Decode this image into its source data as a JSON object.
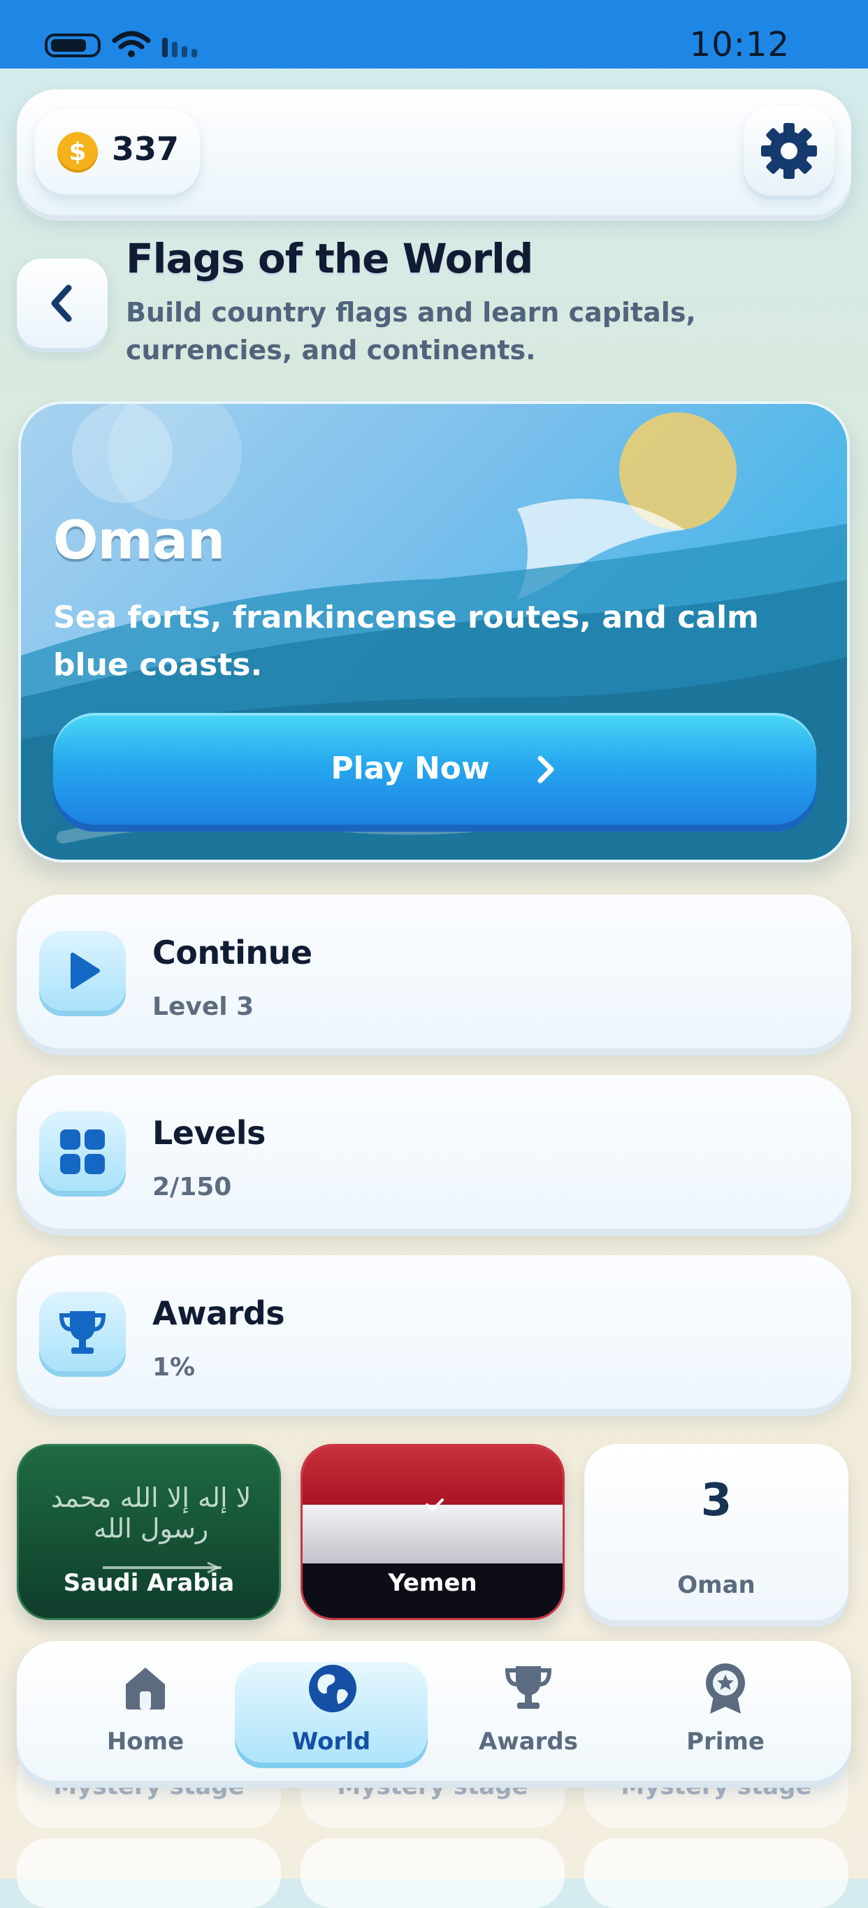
{
  "status_bar": {
    "time": "10:12"
  },
  "header": {
    "coins": "337",
    "coin_symbol": "$"
  },
  "page": {
    "title": "Flags of the World",
    "subtitle": "Build country flags and learn capitals, currencies, and continents."
  },
  "hero": {
    "country": "Oman",
    "description": "Sea forts, frankincense routes, and calm blue coasts.",
    "play_label": "Play Now"
  },
  "cards": [
    {
      "title": "Continue",
      "subtitle": "Level 3",
      "icon": "play-icon"
    },
    {
      "title": "Levels",
      "subtitle": "2/150",
      "icon": "grid-icon"
    },
    {
      "title": "Awards",
      "subtitle": "1%",
      "icon": "trophy-icon"
    }
  ],
  "stages": [
    {
      "label": "Saudi Arabia",
      "flag_text": "لا إله إلا الله محمد رسول الله"
    },
    {
      "label": "Yemen"
    },
    {
      "number": "3",
      "label": "Oman"
    }
  ],
  "locked_stages": [
    "Mystery stage",
    "Mystery stage",
    "Mystery stage"
  ],
  "tabs": [
    {
      "label": "Home",
      "icon": "home-icon"
    },
    {
      "label": "World",
      "icon": "globe-icon",
      "active": true
    },
    {
      "label": "Awards",
      "icon": "trophy-icon"
    },
    {
      "label": "Prime",
      "icon": "badge-star-icon"
    }
  ],
  "colors": {
    "accent": "#1e86e5",
    "dark_text": "#0f1c33",
    "muted_text": "#5b6b80"
  }
}
